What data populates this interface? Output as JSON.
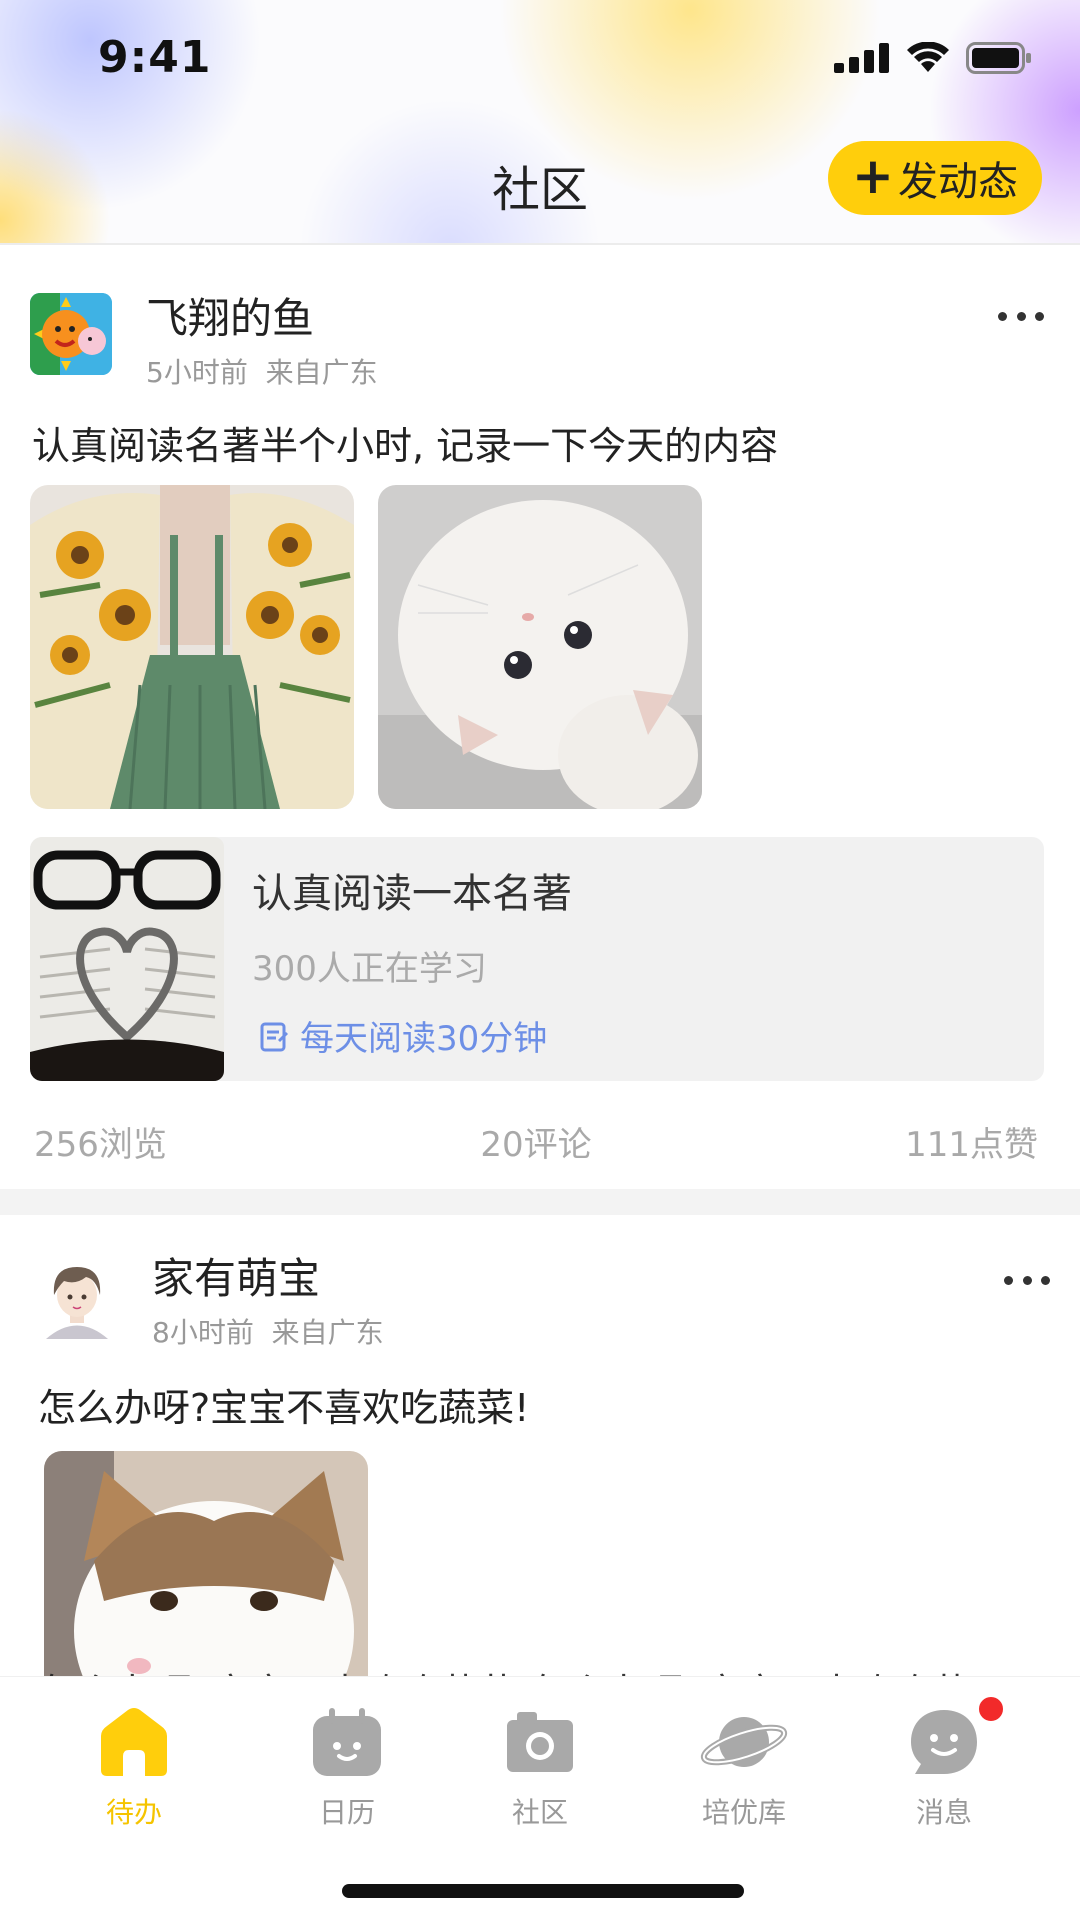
{
  "status_bar": {
    "time": "9:41"
  },
  "header": {
    "title": "社区",
    "post_button": "发动态",
    "post_button_icon": "plus-icon"
  },
  "posts": [
    {
      "username": "飞翔的鱼",
      "time": "5小时前",
      "location": "来自广东",
      "content": "认真阅读名著半个小时, 记录一下今天的内容",
      "course": {
        "title": "认真阅读一本名著",
        "learners": "300人正在学习",
        "plan": "每天阅读30分钟"
      },
      "stats": {
        "views": "256浏览",
        "comments": "20评论",
        "likes": "111点赞"
      }
    },
    {
      "username": "家有萌宝",
      "time": "8小时前",
      "location": "来自广东",
      "content": "怎么办呀?宝宝不喜欢吃蔬菜!",
      "overflow_text": "怎么办呀?宝宝不喜欢吃蔬菜!怎么办呀?宝宝不喜欢吃蔬"
    }
  ],
  "tabbar": {
    "items": [
      {
        "label": "待办",
        "icon": "home-icon",
        "active": true
      },
      {
        "label": "日历",
        "icon": "calendar-icon",
        "active": false
      },
      {
        "label": "社区",
        "icon": "camera-icon",
        "active": false
      },
      {
        "label": "培优库",
        "icon": "planet-icon",
        "active": false
      },
      {
        "label": "消息",
        "icon": "chat-smile-icon",
        "active": false,
        "has_badge": true
      }
    ]
  },
  "colors": {
    "accent": "#ffce0c",
    "active_tab": "#f5c400",
    "link": "#6d8fe6",
    "badge": "#f22a2a"
  }
}
